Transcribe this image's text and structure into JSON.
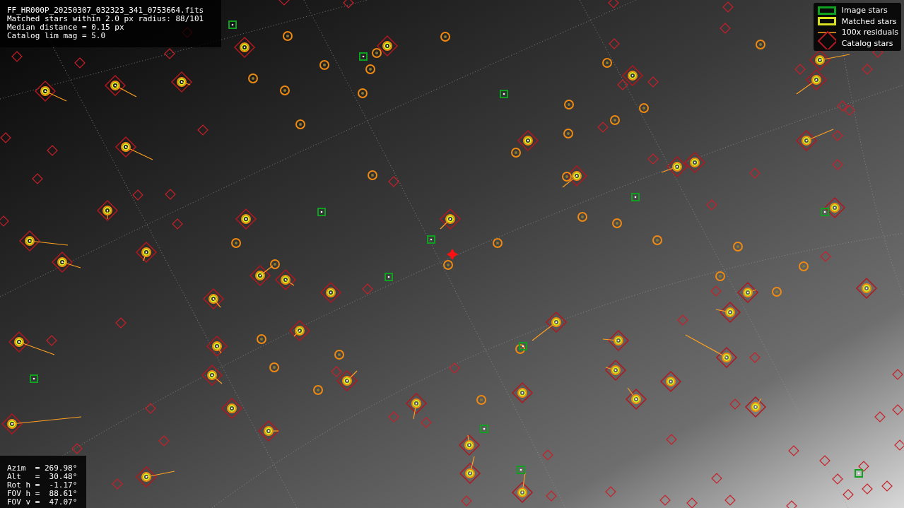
{
  "info_box": {
    "lines": [
      "FF_HR000P_20250307_032323_341_0753664.fits",
      "Matched stars within 2.0 px radius: 88/101",
      "Median distance = 0.15 px",
      "Catalog lim mag = 5.0"
    ]
  },
  "legend": [
    {
      "kind": "image",
      "label": "Image stars"
    },
    {
      "kind": "matched",
      "label": "Matched stars"
    },
    {
      "kind": "residual",
      "label": "100x residuals"
    },
    {
      "kind": "catalog",
      "label": "Catalog stars"
    }
  ],
  "pointing_box": {
    "lines": [
      "Azim  = 269.98°",
      "Alt   =  30.48°",
      "Rot h =  -1.17°",
      "FOV h =  88.61°",
      "FOV v =  47.07°"
    ]
  }
}
